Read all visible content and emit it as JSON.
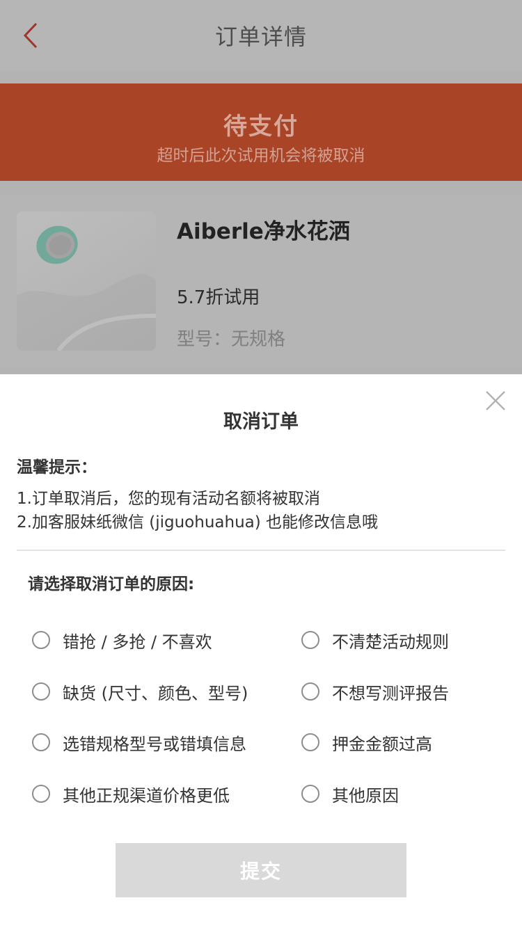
{
  "nav": {
    "title": "订单详情",
    "back_icon": "chevron-left-icon"
  },
  "status": {
    "title": "待支付",
    "subtitle": "超时后此次试用机会将被取消",
    "color": "#a94426"
  },
  "product": {
    "name": "Aiberle净水花洒",
    "price_text": "5.7折试用",
    "spec": "型号：无规格"
  },
  "modal": {
    "title": "取消订单",
    "close_icon": "close-icon",
    "tip_heading": "温馨提示：",
    "tips": [
      "1.订单取消后，您的现有活动名额将被取消",
      "2.加客服妹纸微信 (jiguohuahua) 也能修改信息哦"
    ],
    "reason_heading": "请选择取消订单的原因:",
    "reasons": [
      "错抢 / 多抢 / 不喜欢",
      "不清楚活动规则",
      "缺货 (尺寸、颜色、型号)",
      "不想写测评报告",
      "选错规格型号或错填信息",
      "押金金额过高",
      "其他正规渠道价格更低",
      "其他原因"
    ],
    "submit_label": "提交"
  }
}
